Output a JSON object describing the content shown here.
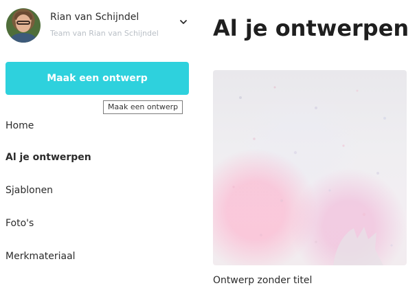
{
  "account": {
    "name": "Rian van Schijndel",
    "team": "Team van Rian van Schijndel"
  },
  "create_button": {
    "label": "Maak een ontwerp",
    "tooltip": "Maak een ontwerp"
  },
  "nav": {
    "items": [
      {
        "label": "Home"
      },
      {
        "label": "Al je ontwerpen",
        "active": true
      },
      {
        "label": "Sjablonen"
      },
      {
        "label": "Foto's"
      },
      {
        "label": "Merkmateriaal"
      }
    ]
  },
  "main": {
    "title": "Al je ontwerpen",
    "designs": [
      {
        "title": "Ontwerp zonder titel",
        "thumbnail": "confetti-concert-crowd"
      }
    ]
  },
  "icons": {
    "account_menu": "chevron-down-icon"
  },
  "colors": {
    "primary": "#2ed1dd",
    "text": "#2b2b2b",
    "muted": "#b9bfc6"
  }
}
